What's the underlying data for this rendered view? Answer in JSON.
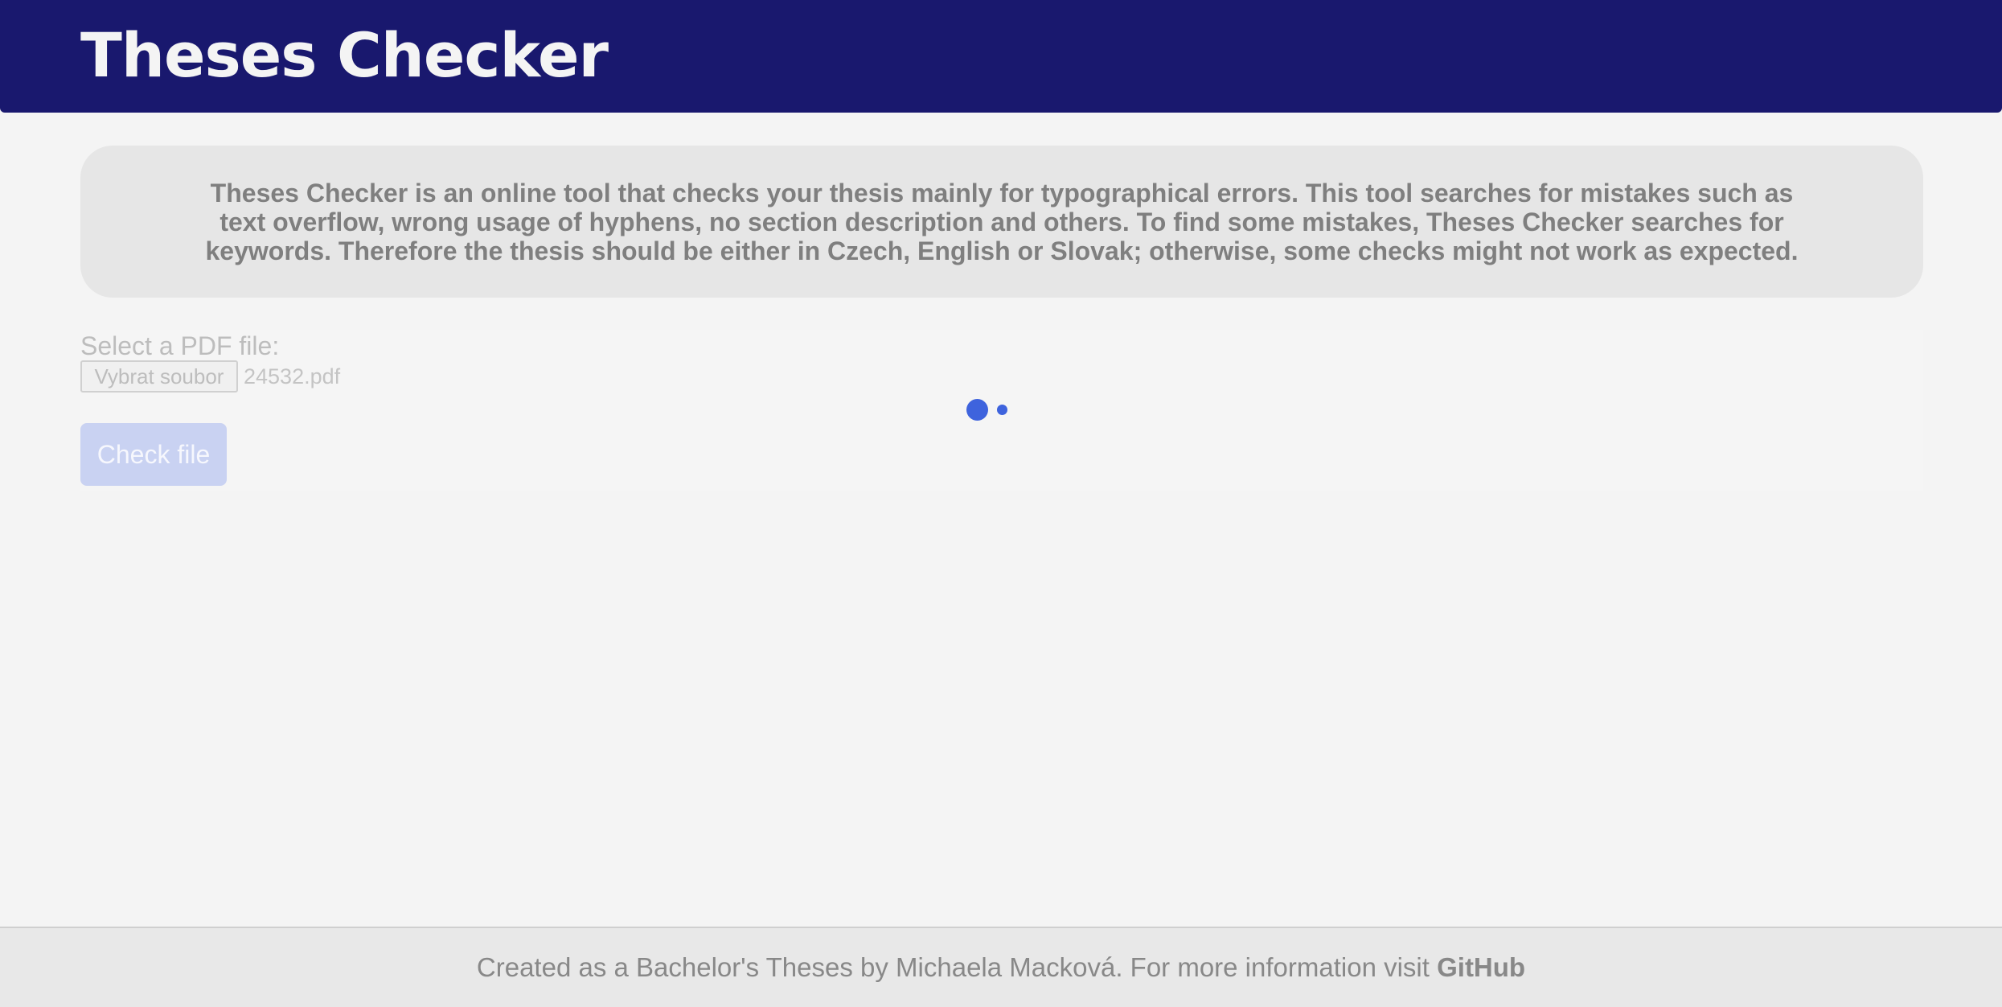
{
  "header": {
    "title": "Theses Checker"
  },
  "intro": {
    "text": "Theses Checker is an online tool that checks your thesis mainly for typographical errors. This tool searches for mistakes such as text overflow, wrong usage of hyphens, no section description and others. To find some mistakes, Theses Checker searches for keywords. Therefore the thesis should be either in Czech, English or Slovak; otherwise, some checks might not work as expected."
  },
  "form": {
    "select_label": "Select a PDF file:",
    "file_button_label": "Vybrat soubor",
    "file_name": "24532.pdf",
    "check_button_label": "Check file"
  },
  "loading": {
    "indicator_icon": "loading-dots-icon",
    "color": "#3e63dd"
  },
  "footer": {
    "text": "Created as a Bachelor's Theses by Michaela Macková. For more information visit",
    "link_label": "GitHub"
  },
  "colors": {
    "header_bg": "#19186e",
    "page_bg": "#f4f4f4",
    "intro_bg": "#e6e6e6",
    "button_disabled_bg": "#c9d2f2"
  }
}
